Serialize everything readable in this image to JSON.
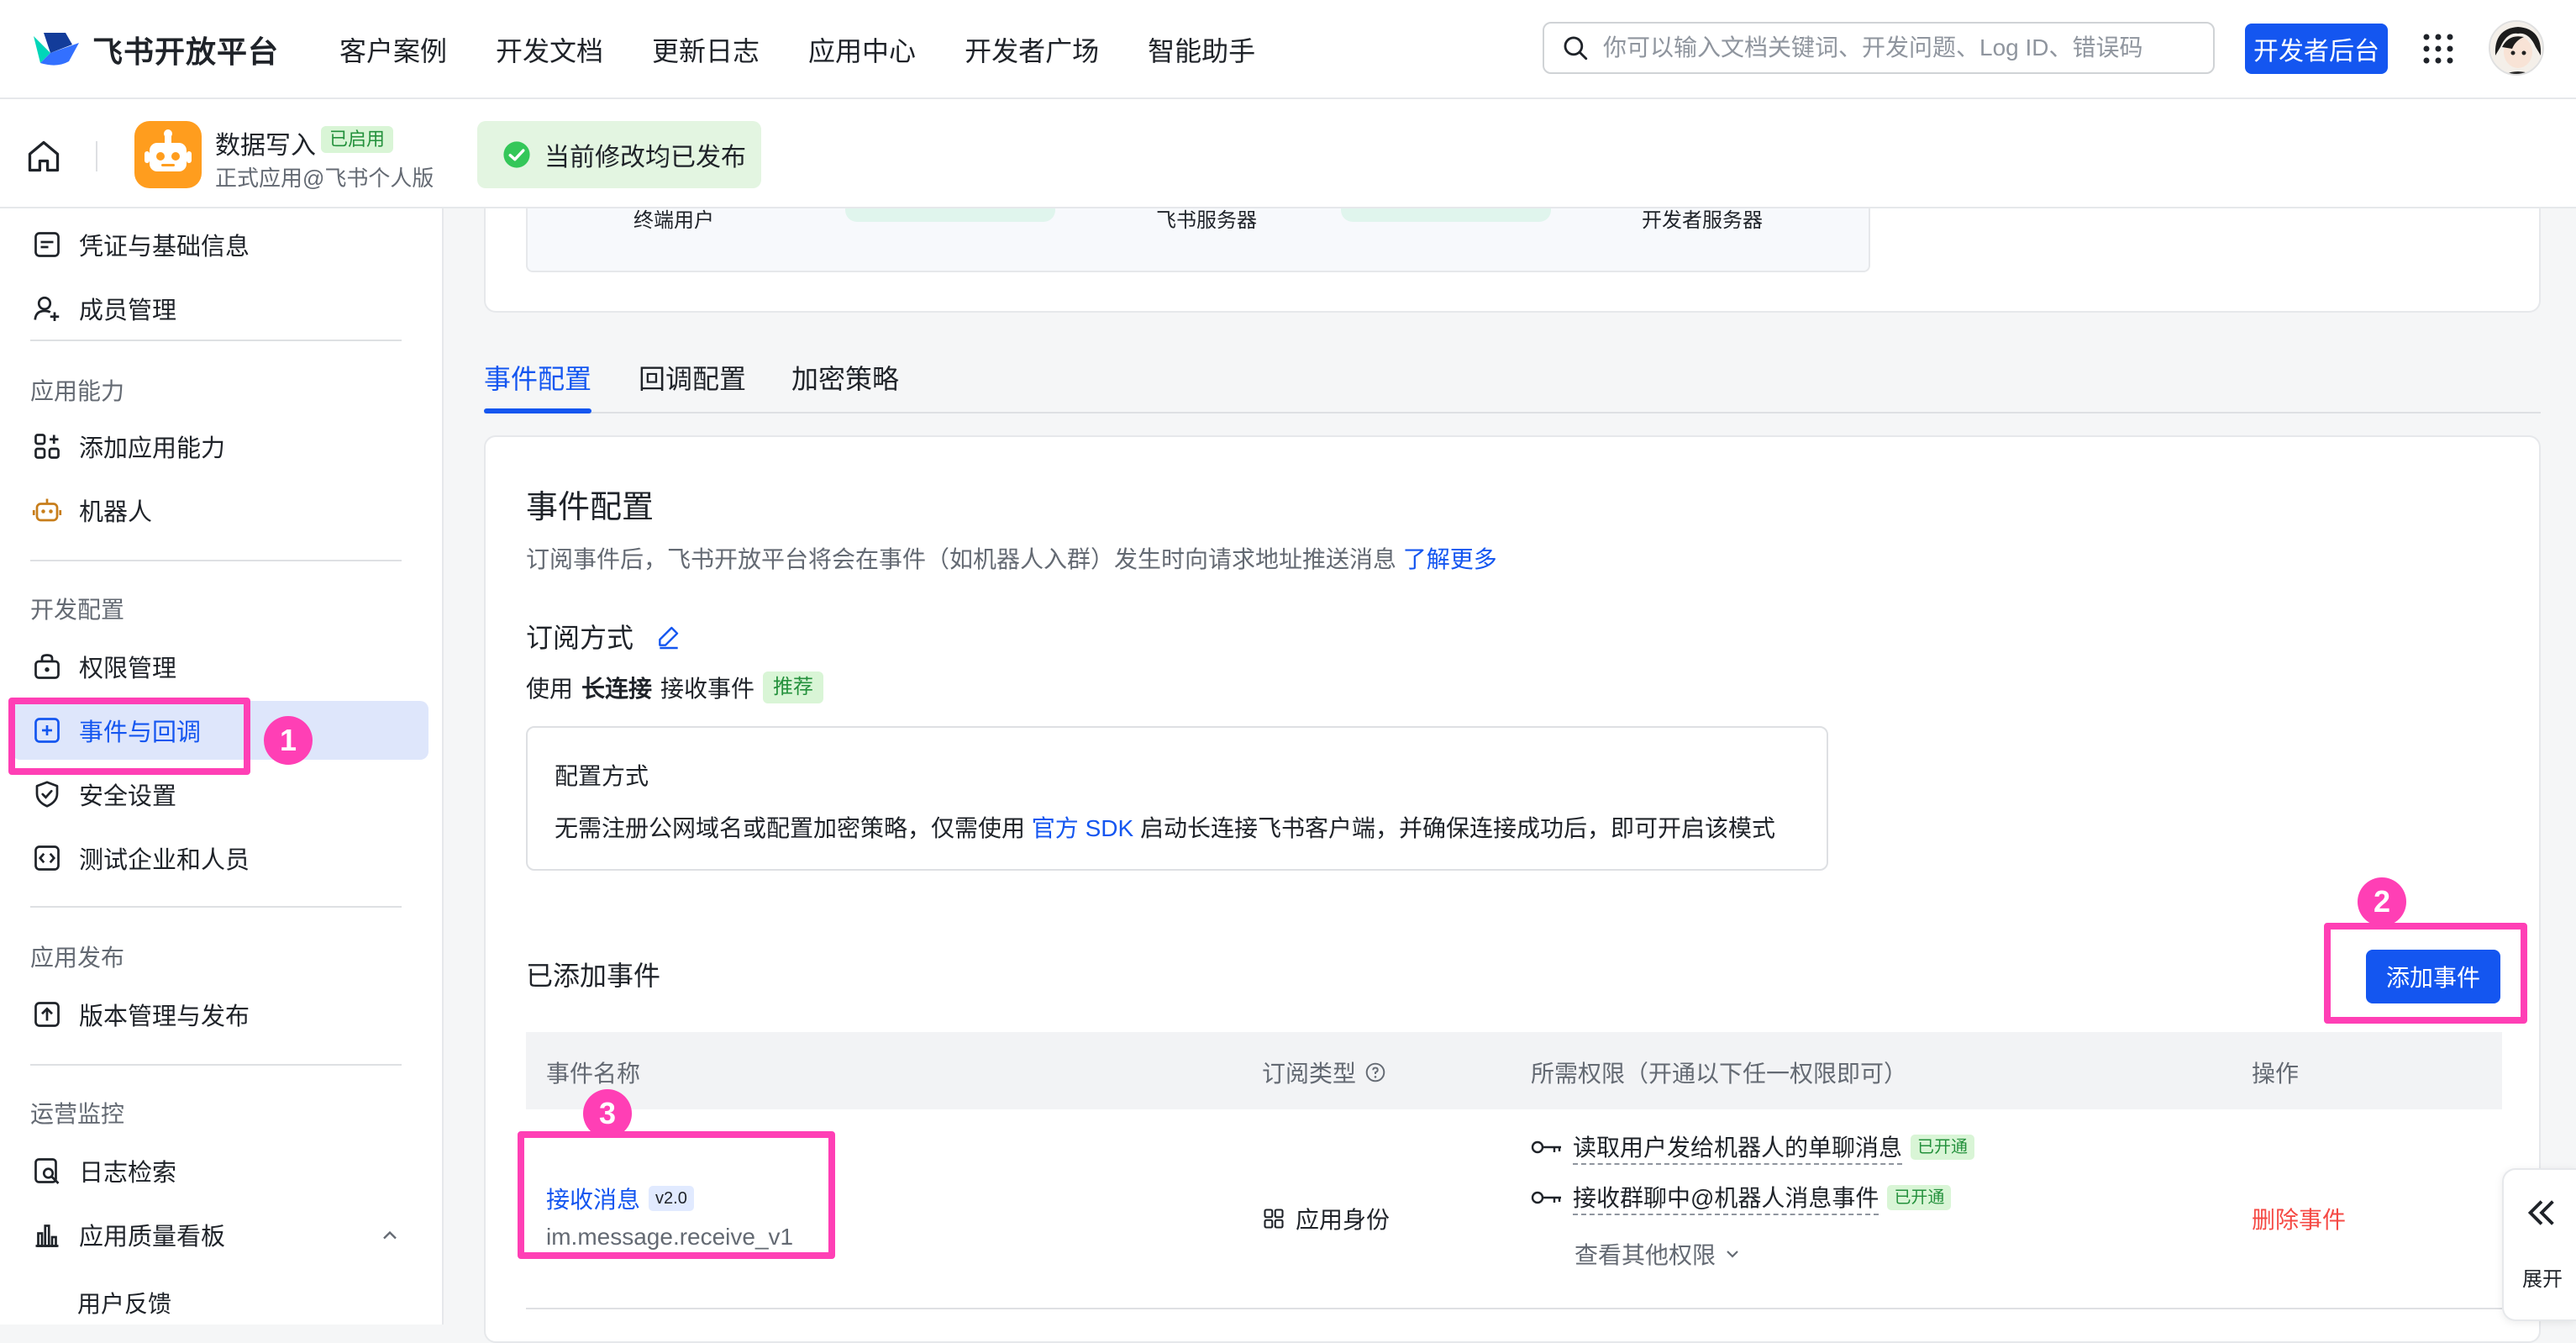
{
  "topnav": {
    "brand": "飞书开放平台",
    "links": [
      "客户案例",
      "开发文档",
      "更新日志",
      "应用中心",
      "开发者广场",
      "智能助手"
    ],
    "search_placeholder": "你可以输入文档关键词、开发问题、Log ID、错误码",
    "dev_console": "开发者后台"
  },
  "appbar": {
    "app_name": "数据写入",
    "app_status": "已启用",
    "app_sub": "正式应用@飞书个人版",
    "toast": "当前修改均已发布"
  },
  "sidebar": {
    "items_top": [
      "凭证与基础信息",
      "成员管理"
    ],
    "group_capability": "应用能力",
    "items_capability": [
      "添加应用能力",
      "机器人"
    ],
    "group_dev": "开发配置",
    "items_dev": [
      "权限管理",
      "事件与回调",
      "安全设置",
      "测试企业和人员"
    ],
    "group_release": "应用发布",
    "items_release": [
      "版本管理与发布"
    ],
    "group_ops": "运营监控",
    "items_ops": [
      "日志检索",
      "应用质量看板"
    ],
    "sub_items": [
      "用户反馈"
    ]
  },
  "diagram": {
    "labels": [
      "终端用户",
      "飞书服务器",
      "开发者服务器"
    ]
  },
  "tabs": [
    "事件配置",
    "回调配置",
    "加密策略"
  ],
  "event_config": {
    "title": "事件配置",
    "desc": "订阅事件后，飞书开放平台将会在事件（如机器人入群）发生时向请求地址推送消息",
    "learn_more": "了解更多",
    "subscribe_title": "订阅方式",
    "subscribe_prefix": "使用",
    "subscribe_method": "长连接",
    "subscribe_suffix": "接收事件",
    "recommend": "推荐",
    "config_title": "配置方式",
    "config_desc_prefix": "无需注册公网域名或配置加密策略，仅需使用",
    "config_link": "官方 SDK",
    "config_desc_suffix": "启动长连接飞书客户端，并确保连接成功后，即可开启该模式"
  },
  "added": {
    "title": "已添加事件",
    "add_button": "添加事件",
    "columns": [
      "事件名称",
      "订阅类型",
      "所需权限（开通以下任一权限即可）",
      "操作"
    ],
    "rows": [
      {
        "name": "接收消息",
        "version": "v2.0",
        "code": "im.message.receive_v1",
        "sub_type": "应用身份",
        "permissions": [
          {
            "text": "读取用户发给机器人的单聊消息",
            "status": "已开通"
          },
          {
            "text": "接收群聊中@机器人消息事件",
            "status": "已开通"
          }
        ],
        "more": "查看其他权限",
        "action": "删除事件"
      }
    ]
  },
  "annotations": [
    "1",
    "2",
    "3"
  ],
  "expand_label": "展开",
  "colors": {
    "primary": "#1456f0",
    "highlight": "#ff3fb5",
    "success_bg": "#d9f5d6",
    "success_text": "#24913c",
    "danger": "#f54a45",
    "app_icon": "#ff9d1e"
  }
}
